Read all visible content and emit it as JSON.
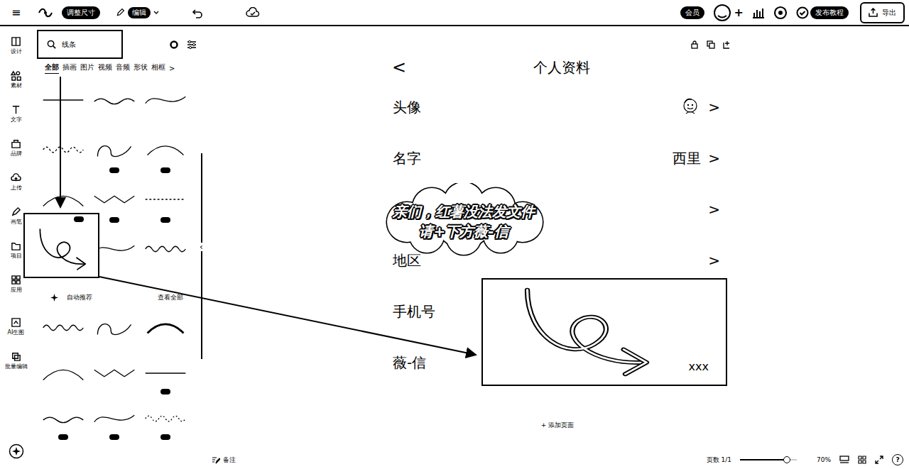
{
  "toolbar": {
    "menu": "≡",
    "resize": "调整尺寸",
    "edit": "编辑",
    "member": "会员",
    "add": "+",
    "tutorial": "发布教程",
    "export": "导出"
  },
  "rail": {
    "items": [
      {
        "label": "设计",
        "selected": false
      },
      {
        "label": "素材",
        "selected": false
      },
      {
        "label": "文字",
        "selected": false
      },
      {
        "label": "品牌",
        "selected": false
      },
      {
        "label": "上传",
        "selected": false
      },
      {
        "label": "画笔",
        "selected": false
      },
      {
        "label": "项目",
        "selected": false
      },
      {
        "label": "应用",
        "selected": false
      },
      {
        "label": "AI生图",
        "selected": false
      },
      {
        "label": "批量编辑",
        "selected": false
      }
    ]
  },
  "panel": {
    "search": {
      "value": "线条"
    },
    "tabs": [
      {
        "label": "全部",
        "selected": true
      },
      {
        "label": "插画",
        "selected": false
      },
      {
        "label": "图片",
        "selected": false
      },
      {
        "label": "视频",
        "selected": false
      },
      {
        "label": "音频",
        "selected": false
      },
      {
        "label": "形状",
        "selected": false
      },
      {
        "label": "相框",
        "selected": false
      }
    ],
    "tabs_more": ">",
    "top_thumbnails": [
      {
        "premium": false
      },
      {
        "premium": false
      },
      {
        "premium": false
      },
      {
        "premium": false
      },
      {
        "premium": true
      },
      {
        "premium": true
      },
      {
        "premium": true
      },
      {
        "premium": true
      },
      {
        "premium": true
      },
      {
        "premium": false
      },
      {
        "premium": false
      },
      {
        "premium": false
      }
    ],
    "section": {
      "title": "自动推荐",
      "link": "查看全部"
    },
    "bottom_thumbnails": [
      {
        "premium": false
      },
      {
        "premium": false
      },
      {
        "premium": false
      },
      {
        "premium": false
      },
      {
        "premium": false
      },
      {
        "premium": true
      },
      {
        "premium": true
      },
      {
        "premium": true
      },
      {
        "premium": true
      }
    ],
    "collapse": "‹",
    "zoomed_thumbnail": {
      "premium": true
    }
  },
  "page": {
    "back": "<",
    "title": "个人资料",
    "rows": [
      {
        "label": "头像",
        "value": "",
        "chevron": ">",
        "kind": "avatar"
      },
      {
        "label": "名字",
        "value": "西里",
        "chevron": ">",
        "kind": "text"
      },
      {
        "label": "",
        "value": "",
        "chevron": ">",
        "kind": "text"
      },
      {
        "label": "地区",
        "value": "",
        "chevron": ">",
        "kind": "text"
      },
      {
        "label": "手机号",
        "value": "",
        "chevron": "",
        "kind": "text"
      },
      {
        "label": "薇-信",
        "value": "",
        "chevron": "",
        "kind": "text"
      }
    ],
    "cloud": {
      "lines": [
        "亲们，红薯没法发文件",
        "请+下方薇-信"
      ]
    },
    "callout": {
      "text": "xxx"
    }
  },
  "add_page": "+ 添加页面",
  "bottom_bar": {
    "notes": "备注",
    "pages": "页数 1/1",
    "zoom": {
      "level": 0.82,
      "reading": "70%"
    },
    "help": "?"
  }
}
